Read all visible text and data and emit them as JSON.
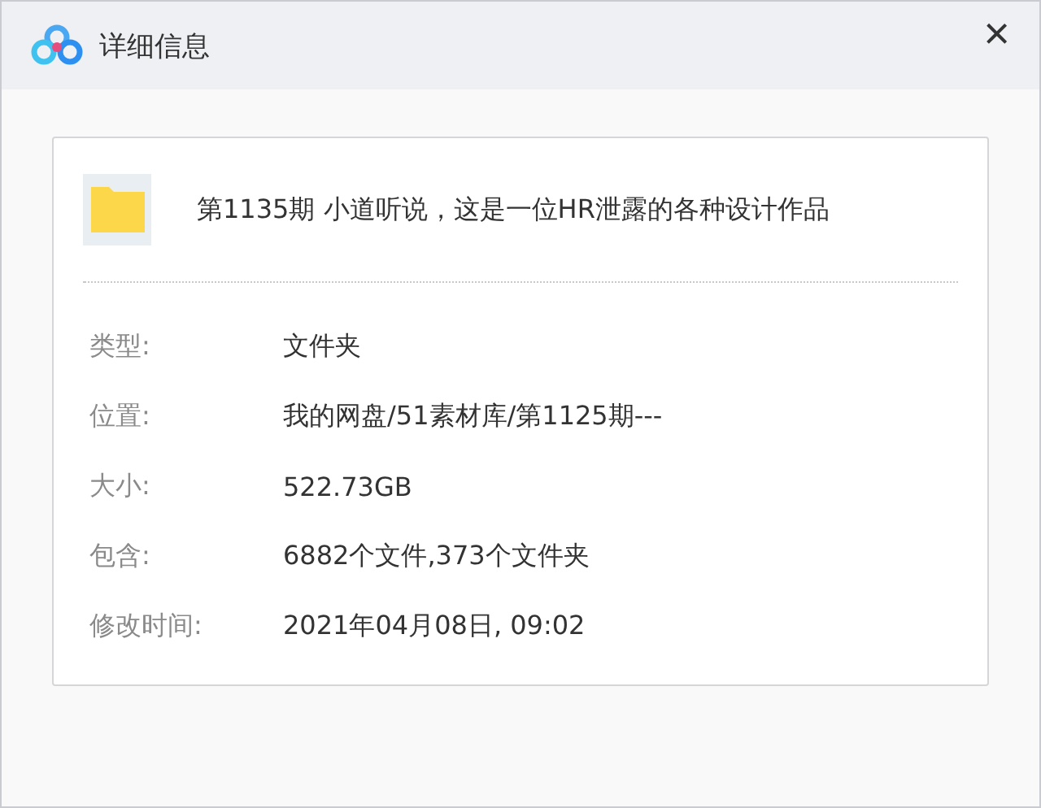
{
  "window": {
    "title": "详细信息",
    "close": "×"
  },
  "item": {
    "name": "第1135期 小道听说，这是一位HR泄露的各种设计作品"
  },
  "properties": [
    {
      "label": "类型:",
      "value": "文件夹"
    },
    {
      "label": "位置:",
      "value": "我的网盘/51素材库/第1125期---"
    },
    {
      "label": "大小:",
      "value": "522.73GB"
    },
    {
      "label": "包含:",
      "value": "6882个文件,373个文件夹"
    },
    {
      "label": "修改时间:",
      "value": "2021年04月08日, 09:02"
    }
  ]
}
